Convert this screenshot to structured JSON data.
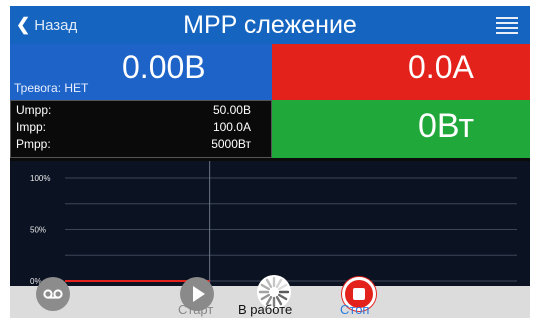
{
  "header": {
    "back_label": "Назад",
    "title": "MPP слежение"
  },
  "tiles": {
    "voltage": "0.00В",
    "alarm": "Тревога: НЕТ",
    "current": "0.0А",
    "power": "0Вт"
  },
  "params": [
    {
      "name": "Umpp:",
      "value": "50.00В"
    },
    {
      "name": "Impp:",
      "value": "100.0А"
    },
    {
      "name": "Pmpp:",
      "value": "5000Вт"
    }
  ],
  "colors": {
    "header": "#1565c0",
    "voltage": "#1e63c8",
    "current": "#e4221c",
    "power": "#21a83a",
    "chart_bg": "#0b1222",
    "curve": "#e4221c"
  },
  "chart_data": {
    "type": "line",
    "yticks": [
      "100%",
      "50%",
      "0%"
    ],
    "ylim": [
      0,
      100
    ],
    "xlim": [
      0,
      100
    ],
    "series": [
      {
        "x": [
          0,
          32
        ],
        "y": [
          0,
          0
        ]
      }
    ],
    "cursor_x": 32,
    "grid": true
  },
  "controls": {
    "start": "Старт",
    "running": "В работе",
    "stop": "Стоп"
  },
  "icons": {
    "back": "chevron-left-icon",
    "menu": "hamburger-menu-icon",
    "voicemail": "voicemail-icon",
    "start": "play-icon",
    "running": "spinner-icon",
    "stop": "stop-icon"
  }
}
